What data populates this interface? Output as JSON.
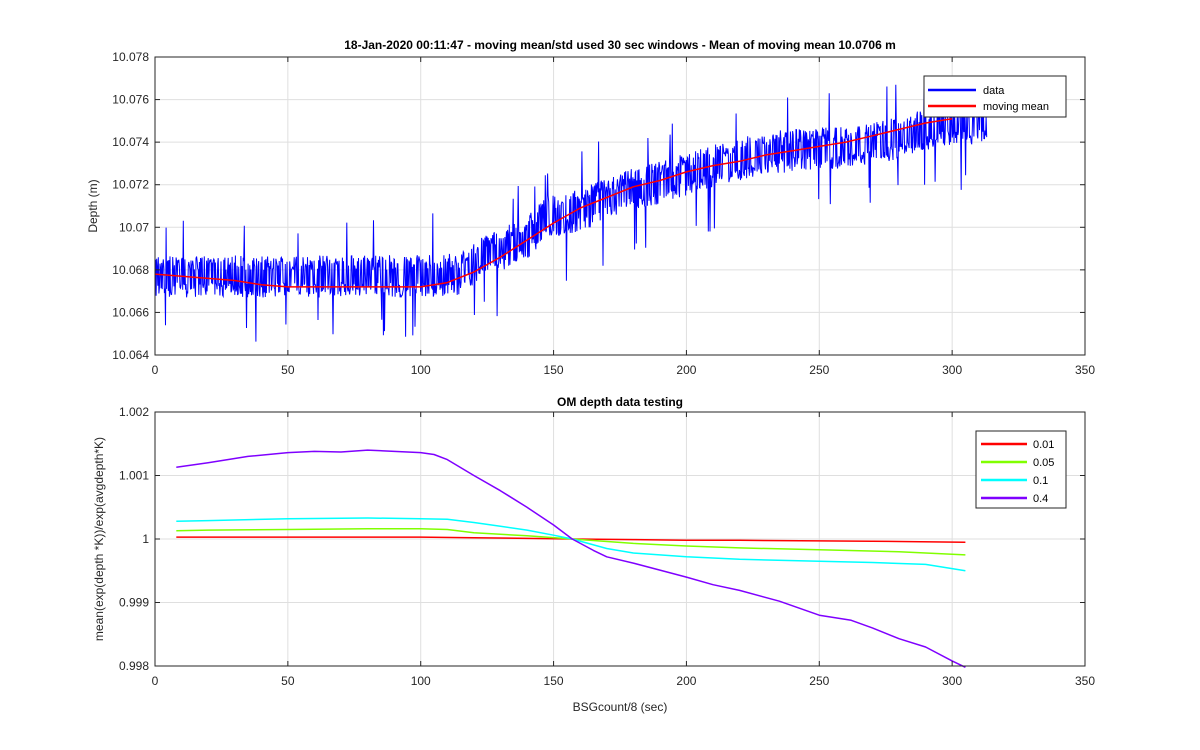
{
  "chart_data": [
    {
      "type": "line",
      "title": "18-Jan-2020 00:11:47 - moving mean/std used 30 sec windows - Mean of moving mean 10.0706 m",
      "xlabel": "",
      "ylabel": "Depth (m)",
      "xlim": [
        0,
        350
      ],
      "ylim": [
        10.064,
        10.078
      ],
      "xticks": [
        0,
        50,
        100,
        150,
        200,
        250,
        300,
        350
      ],
      "yticks": [
        10.064,
        10.066,
        10.068,
        10.07,
        10.072,
        10.074,
        10.076,
        10.078
      ],
      "ytick_labels": [
        "10.064",
        "10.066",
        "10.068",
        "10.07",
        "10.072",
        "10.074",
        "10.076",
        "10.078"
      ],
      "grid": true,
      "legend_position": "top-right",
      "series": [
        {
          "name": "data",
          "color": "#0000ff",
          "base_level": [
            [
              0,
              10.0677
            ],
            [
              100,
              10.0677
            ],
            [
              115,
              10.0678
            ],
            [
              122,
              10.0685
            ],
            [
              140,
              10.0695
            ],
            [
              148,
              10.0705
            ],
            [
              160,
              10.0708
            ],
            [
              180,
              10.0718
            ],
            [
              190,
              10.0721
            ],
            [
              205,
              10.0727
            ],
            [
              230,
              10.0735
            ],
            [
              250,
              10.0737
            ],
            [
              265,
              10.0738
            ],
            [
              280,
              10.0742
            ],
            [
              295,
              10.0748
            ],
            [
              313,
              10.0749
            ]
          ],
          "band_half_width": 0.001,
          "spike_max": 10.0767,
          "spike_min": 10.0644,
          "x_range": [
            0,
            313
          ]
        },
        {
          "name": "moving mean",
          "color": "#ff0000",
          "x": [
            0,
            10,
            20,
            30,
            40,
            50,
            60,
            70,
            80,
            90,
            100,
            110,
            120,
            130,
            140,
            150,
            160,
            170,
            180,
            190,
            200,
            210,
            220,
            230,
            240,
            250,
            260,
            270,
            280,
            290,
            300
          ],
          "y": [
            10.0678,
            10.0677,
            10.0676,
            10.0675,
            10.0673,
            10.0672,
            10.0672,
            10.0672,
            10.0672,
            10.0672,
            10.0672,
            10.0674,
            10.0679,
            10.0686,
            10.0694,
            10.0702,
            10.0709,
            10.0714,
            10.0719,
            10.0722,
            10.0726,
            10.0729,
            10.0731,
            10.0734,
            10.0736,
            10.0738,
            10.074,
            10.0743,
            10.0746,
            10.0749,
            10.0751
          ]
        }
      ]
    },
    {
      "type": "line",
      "title": "OM depth data testing",
      "xlabel": "BSGcount/8 (sec)",
      "ylabel": "mean(exp(depth *K))/exp(avgdepth*K)",
      "xlim": [
        0,
        350
      ],
      "ylim": [
        0.998,
        1.002
      ],
      "xticks": [
        0,
        50,
        100,
        150,
        200,
        250,
        300,
        350
      ],
      "yticks": [
        0.998,
        0.999,
        1,
        1.001,
        1.002
      ],
      "ytick_labels": [
        "0.998",
        "0.999",
        "1",
        "1.001",
        "1.002"
      ],
      "grid": true,
      "legend_position": "top-right",
      "series": [
        {
          "name": "0.01",
          "color": "#ff0000",
          "x": [
            8,
            20,
            50,
            80,
            100,
            120,
            140,
            157,
            180,
            200,
            220,
            250,
            280,
            305
          ],
          "y": [
            1.00003,
            1.00003,
            1.00003,
            1.00003,
            1.00003,
            1.00002,
            1.00001,
            1.0,
            0.99999,
            0.99998,
            0.99998,
            0.99997,
            0.99996,
            0.99995
          ]
        },
        {
          "name": "0.05",
          "color": "#80ff00",
          "x": [
            8,
            20,
            50,
            80,
            100,
            110,
            120,
            140,
            157,
            180,
            200,
            220,
            250,
            280,
            305
          ],
          "y": [
            1.00013,
            1.00014,
            1.00015,
            1.00016,
            1.00016,
            1.00015,
            1.0001,
            1.00005,
            1.0,
            0.99993,
            0.99989,
            0.99986,
            0.99983,
            0.9998,
            0.99975
          ]
        },
        {
          "name": "0.1",
          "color": "#00ffff",
          "x": [
            8,
            20,
            50,
            80,
            100,
            110,
            120,
            130,
            140,
            150,
            157,
            170,
            180,
            200,
            220,
            250,
            270,
            290,
            305
          ],
          "y": [
            1.00028,
            1.00029,
            1.00032,
            1.00033,
            1.00032,
            1.00031,
            1.00026,
            1.0002,
            1.00014,
            1.00006,
            1.0,
            0.99985,
            0.99978,
            0.99972,
            0.99968,
            0.99965,
            0.99963,
            0.9996,
            0.9995
          ]
        },
        {
          "name": "0.4",
          "color": "#7f00ff",
          "x": [
            8,
            20,
            35,
            50,
            60,
            70,
            80,
            90,
            100,
            105,
            110,
            120,
            130,
            140,
            150,
            157,
            165,
            170,
            180,
            190,
            200,
            210,
            220,
            235,
            250,
            262,
            270,
            280,
            290,
            300,
            305
          ],
          "y": [
            1.00113,
            1.0012,
            1.0013,
            1.00136,
            1.00138,
            1.00137,
            1.0014,
            1.00138,
            1.00136,
            1.00133,
            1.00125,
            1.001,
            1.00076,
            1.0005,
            1.00022,
            1.0,
            0.99982,
            0.99972,
            0.99962,
            0.99951,
            0.9994,
            0.99928,
            0.99919,
            0.99902,
            0.9988,
            0.99872,
            0.9986,
            0.99843,
            0.9983,
            0.99808,
            0.99798
          ]
        }
      ]
    }
  ]
}
